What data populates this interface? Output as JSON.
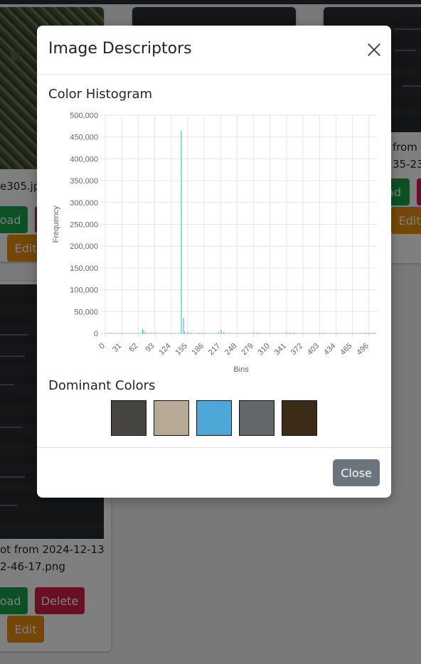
{
  "background": {
    "cards": [
      {
        "caption1": "e305.jp",
        "btn_download": "oad",
        "btn_edit": "Edit"
      },
      {
        "caption1": "from 2",
        "caption2": "35-23."
      },
      {
        "btn_download": "ad",
        "btn_edit": "Edit"
      },
      {
        "caption1": "ot from 2024-12-13",
        "caption2": "2-46-17.png",
        "btn_download": "oad",
        "btn_delete": "Delete",
        "btn_edit": "Edit"
      }
    ]
  },
  "modal": {
    "title": "Image Descriptors",
    "histogram_title": "Color Histogram",
    "dominant_title": "Dominant Colors",
    "close_label": "Close",
    "dominant_colors": [
      "#474542",
      "#b6a996",
      "#4ea7d6",
      "#646769",
      "#3c2c17"
    ]
  },
  "chart_data": {
    "type": "bar",
    "xlabel": "Bins",
    "ylabel": "Frequency",
    "ylim": [
      0,
      500000
    ],
    "yticks": [
      0,
      50000,
      100000,
      150000,
      200000,
      250000,
      300000,
      350000,
      400000,
      450000,
      500000
    ],
    "ytick_labels": [
      "0",
      "50,000",
      "100,000",
      "150,000",
      "200,000",
      "250,000",
      "300,000",
      "350,000",
      "400,000",
      "450,000",
      "500,000"
    ],
    "xlim": [
      0,
      511
    ],
    "xticks": [
      0,
      31,
      62,
      93,
      124,
      155,
      186,
      217,
      248,
      279,
      310,
      341,
      372,
      403,
      434,
      465,
      496
    ],
    "color": "#4bc0c0",
    "bins": [
      {
        "x": 70,
        "y": 10000
      },
      {
        "x": 72,
        "y": 6000
      },
      {
        "x": 76,
        "y": 3000
      },
      {
        "x": 85,
        "y": 2000
      },
      {
        "x": 96,
        "y": 2000
      },
      {
        "x": 143,
        "y": 465000
      },
      {
        "x": 147,
        "y": 35000
      },
      {
        "x": 149,
        "y": 4000
      },
      {
        "x": 155,
        "y": 3000
      },
      {
        "x": 160,
        "y": 2000
      },
      {
        "x": 175,
        "y": 2000
      },
      {
        "x": 181,
        "y": 1500
      },
      {
        "x": 213,
        "y": 3000
      },
      {
        "x": 218,
        "y": 8000
      },
      {
        "x": 223,
        "y": 3000
      },
      {
        "x": 233,
        "y": 1500
      },
      {
        "x": 279,
        "y": 2000
      },
      {
        "x": 285,
        "y": 2000
      },
      {
        "x": 290,
        "y": 1500
      },
      {
        "x": 341,
        "y": 2000
      },
      {
        "x": 347,
        "y": 2000
      },
      {
        "x": 355,
        "y": 1500
      },
      {
        "x": 410,
        "y": 1500
      },
      {
        "x": 435,
        "y": 1500
      },
      {
        "x": 490,
        "y": 2000
      },
      {
        "x": 497,
        "y": 1500
      },
      {
        "x": 506,
        "y": 1500
      }
    ]
  }
}
